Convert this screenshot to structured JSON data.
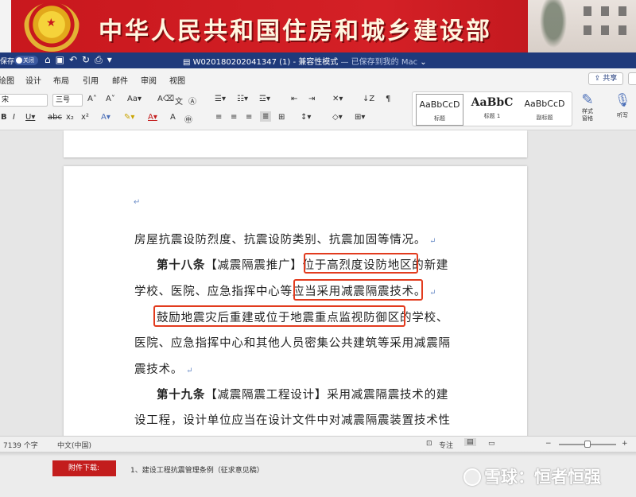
{
  "banner": {
    "title": "中华人民共和国住房和城乡建设部"
  },
  "titlebar": {
    "autosave_label": "保存",
    "autosave_state": "关闭",
    "doc_name": "W020180202041347 (1)",
    "mode": " - 兼容性模式",
    "status": " — 已保存到我的 Mac",
    "chevron": "⌄"
  },
  "tabs": [
    {
      "label": "绘图"
    },
    {
      "label": "设计"
    },
    {
      "label": "布局"
    },
    {
      "label": "引用"
    },
    {
      "label": "邮件"
    },
    {
      "label": "审阅"
    },
    {
      "label": "视图"
    }
  ],
  "share_label": "共享",
  "ribbon": {
    "font_name": "宋",
    "font_size": "三号",
    "styles": [
      {
        "sample": "AaBbCcD",
        "name": "标题"
      },
      {
        "sample": "AaBbC",
        "name": "标题 1"
      },
      {
        "sample": "AaBbCcD",
        "name": "副标题"
      }
    ],
    "pane_label": "样式\n窗格",
    "dictate_label": "听写"
  },
  "document": {
    "line1": "房屋抗震设防烈度、抗震设防类别、抗震加固等情况。",
    "line2_bold": "第十八条",
    "line2_rest": "【减震隔震推广】位于高烈度设防地区的新建",
    "line3": "学校、医院、应急指挥中心等应当采用减震隔震技术。",
    "line4": "鼓励地震灾后重建或位于地震重点监视防御区的学校、",
    "line5": "医院、应急指挥中心和其他人员密集公共建筑等采用减震隔",
    "line6": "震技术。",
    "line7_bold": "第十九条",
    "line7_rest": "【减震隔震工程设计】采用减震隔震技术的建",
    "line8": "设工程，设计单位应当在设计文件中对减震隔震装置技术性"
  },
  "statusbar": {
    "word_count": "7139 个字",
    "language": "中文(中国)",
    "focus": "专注"
  },
  "footer": {
    "download_label": "附件下载:",
    "download_item": "1、建设工程抗震管理条例（征求意见稿）",
    "watermark": "雪球：恒者恒强"
  }
}
